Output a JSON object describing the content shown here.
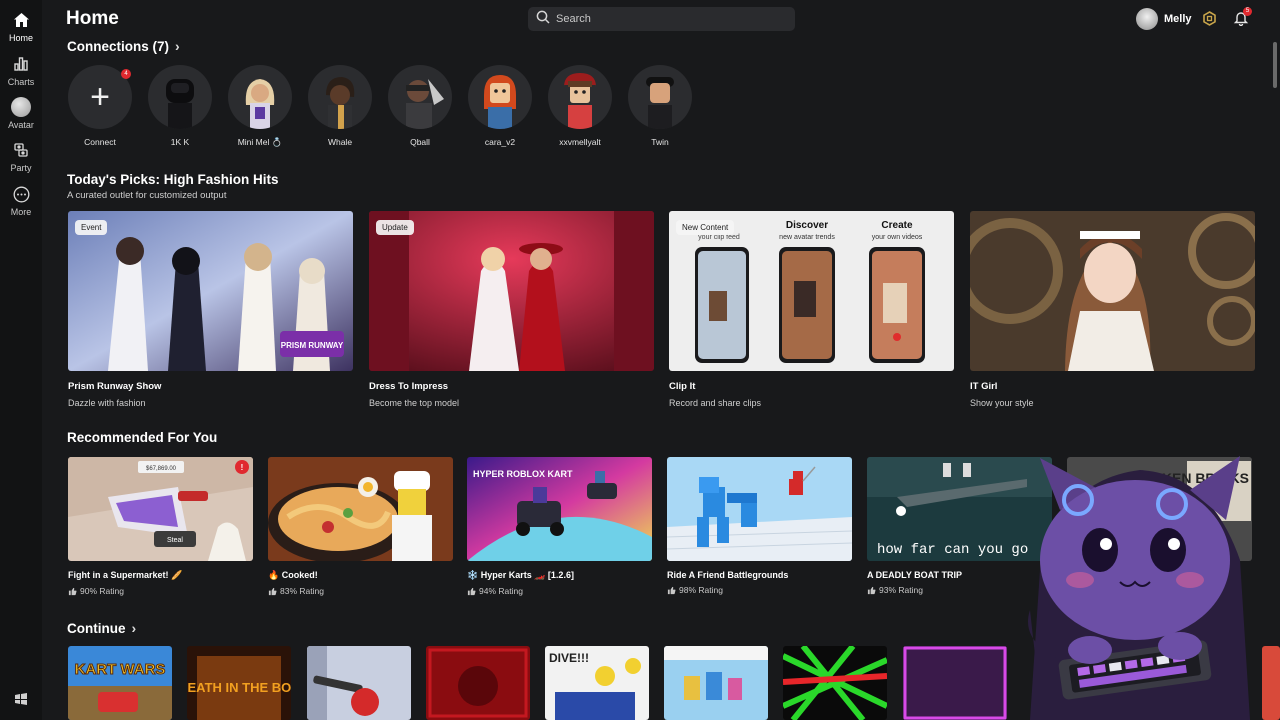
{
  "sidebar": {
    "items": [
      {
        "label": "Home",
        "icon": "home-icon"
      },
      {
        "label": "Charts",
        "icon": "charts-icon"
      },
      {
        "label": "Avatar",
        "icon": "avatar-icon"
      },
      {
        "label": "Party",
        "icon": "party-icon"
      },
      {
        "label": "More",
        "icon": "more-icon"
      }
    ]
  },
  "header": {
    "title": "Home",
    "search_placeholder": "Search",
    "username": "Melly",
    "notification_count": "5"
  },
  "connections": {
    "heading": "Connections (7)",
    "connect_badge": "4",
    "items": [
      {
        "name": "Connect"
      },
      {
        "name": "1K K"
      },
      {
        "name": "Mini Mel 💍"
      },
      {
        "name": "Whale"
      },
      {
        "name": "Qball"
      },
      {
        "name": "cara_v2"
      },
      {
        "name": "xxvmellyalt"
      },
      {
        "name": "Twin"
      }
    ]
  },
  "picks": {
    "heading": "Today's Picks: High Fashion Hits",
    "subheading": "A curated outlet for customized output",
    "items": [
      {
        "tag": "Event",
        "title": "Prism Runway Show",
        "subtitle": "Dazzle with fashion",
        "logo_text": "PRISM RUNWAY"
      },
      {
        "tag": "Update",
        "title": "Dress To Impress",
        "subtitle": "Become the top model"
      },
      {
        "tag": "New Content",
        "title": "Clip It",
        "subtitle": "Record and share clips",
        "thumb_left_caption": "your clip feed",
        "thumb_mid_title": "Discover",
        "thumb_mid_sub": "new avatar trends",
        "thumb_right_title": "Create",
        "thumb_right_sub": "your own videos"
      },
      {
        "tag": "",
        "title": "IT Girl",
        "subtitle": "Show your style"
      }
    ]
  },
  "recommended": {
    "heading": "Recommended For You",
    "items": [
      {
        "title": "Fight in a Supermarket! 🥖",
        "rating": "90% Rating",
        "thumb_text": "Steal",
        "price_text": "$67,869.00"
      },
      {
        "title": "🔥 Cooked!",
        "rating": "83% Rating"
      },
      {
        "title": "❄️ Hyper Karts 🏎️ [1.2.6]",
        "rating": "94% Rating",
        "thumb_text": "HYPER ROBLOX KART"
      },
      {
        "title": "Ride A Friend Battlegrounds",
        "rating": "98% Rating"
      },
      {
        "title": "A DEADLY BOAT TRIP",
        "rating": "93% Rating",
        "thumb_text": "how far can you go"
      },
      {
        "title": "",
        "rating": "",
        "thumb_text": "BROKEN BRICKS"
      }
    ]
  },
  "continue": {
    "heading": "Continue",
    "items": [
      {
        "thumb_text": "KART WARS"
      },
      {
        "thumb_text": "DEATH IN THE BOX"
      },
      {
        "thumb_text": ""
      },
      {
        "thumb_text": ""
      },
      {
        "thumb_text": "DIVE!!!"
      },
      {
        "thumb_text": ""
      },
      {
        "thumb_text": ""
      },
      {
        "thumb_text": ""
      },
      {
        "thumb_text": ""
      }
    ]
  },
  "colors": {
    "background": "#18191b",
    "sidebar": "#121314",
    "accent_badge": "#e0292f",
    "robux_gold": "#c9a54a"
  }
}
